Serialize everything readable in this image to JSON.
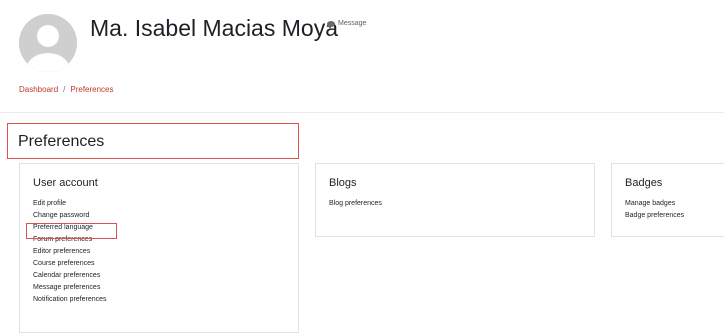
{
  "header": {
    "user_name": "Ma. Isabel Macias Moya",
    "message_label": "Message",
    "avatar_icon": "user-silhouette-icon",
    "message_icon": "chat-bubble-icon"
  },
  "breadcrumb": {
    "items": [
      "Dashboard",
      "Preferences"
    ],
    "separator": "/"
  },
  "page": {
    "title": "Preferences"
  },
  "sections": {
    "user_account": {
      "title": "User account",
      "links": [
        "Edit profile",
        "Change password",
        "Preferred language",
        "Forum preferences",
        "Editor preferences",
        "Course preferences",
        "Calendar preferences",
        "Message preferences",
        "Notification preferences"
      ]
    },
    "blogs": {
      "title": "Blogs",
      "links": [
        "Blog preferences"
      ]
    },
    "badges": {
      "title": "Badges",
      "links": [
        "Manage badges",
        "Badge preferences"
      ]
    }
  },
  "colors": {
    "accent_red": "#d9534f",
    "breadcrumb_link": "#c0392b",
    "avatar_bg": "#cfcfcf"
  }
}
